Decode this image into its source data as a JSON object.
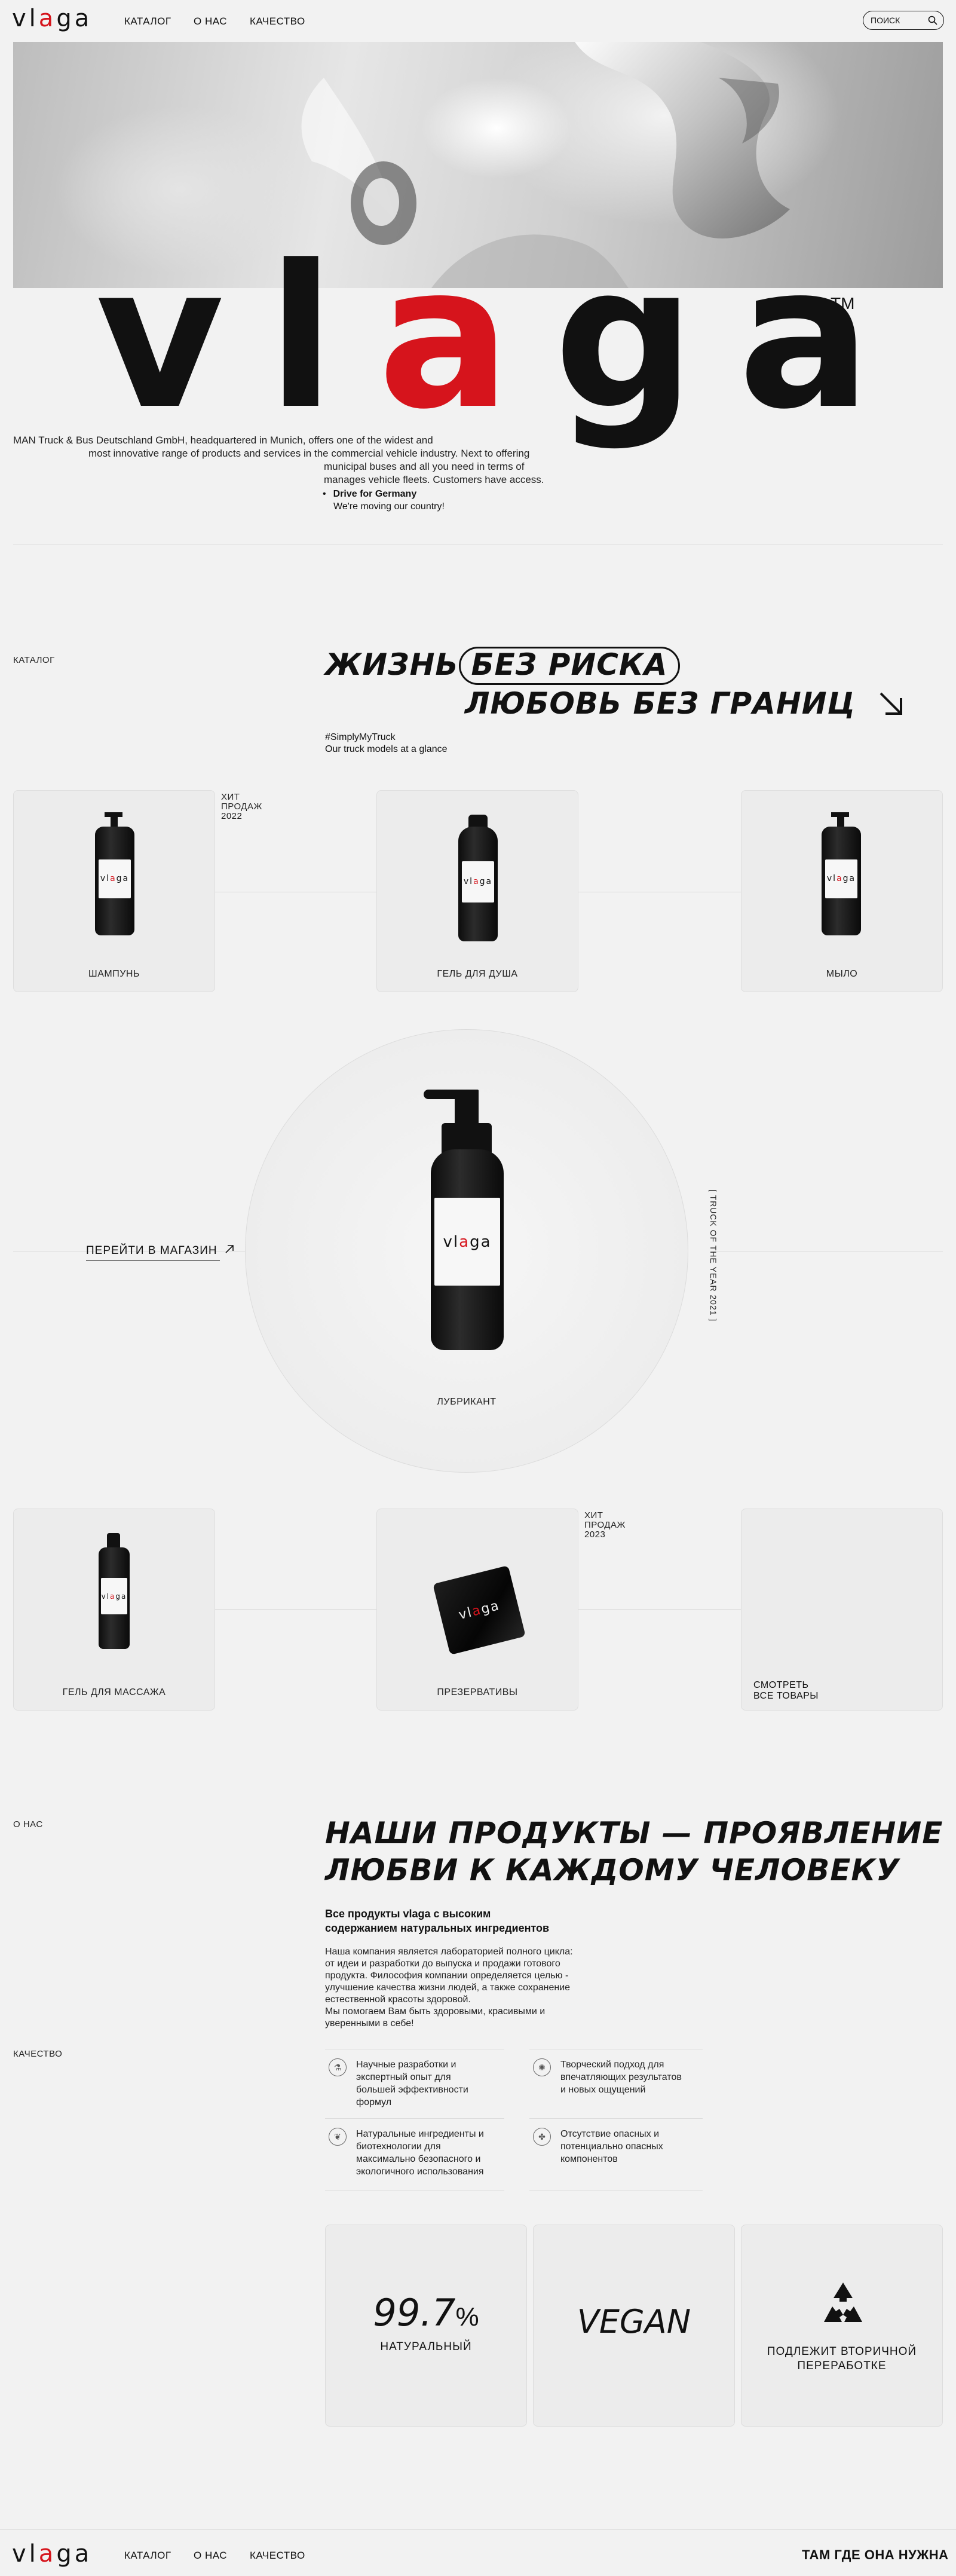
{
  "nav": {
    "logo_parts": [
      "vl",
      "a",
      "ga"
    ],
    "links": [
      "КАТАЛОГ",
      "О НАС",
      "КАЧЕСТВО"
    ],
    "search_label": "ПОИСК"
  },
  "hero": {
    "logo_parts": [
      "vl",
      "a",
      "ga"
    ],
    "trademark": "TM",
    "paragraph_lines": [
      "MAN Truck & Bus Deutschland GmbH, headquartered in Munich, offers one of the widest and",
      "most innovative range of products and services in the commercial vehicle industry. Next to offering",
      "municipal buses and all you need in terms of",
      "manages vehicle fleets. Customers have access."
    ],
    "bullet_title": "Drive for Germany",
    "bullet_text": "We're moving our country!"
  },
  "catalog": {
    "section_label": "КАТАЛОГ",
    "headline_line1_a": "ЖИЗНЬ",
    "headline_line1_pill": "БЕЗ РИСКА",
    "headline_line2": "ЛЮБОВЬ БЕЗ ГРАНИЦ",
    "hashtag": "#SimplyMyTruck",
    "subtitle": "Our truck models at a glance",
    "bestseller_2022": [
      "ХИТ",
      "ПРОДАЖ",
      "2022"
    ],
    "bestseller_2023": [
      "ХИТ",
      "ПРОДАЖ",
      "2023"
    ],
    "products_row1": [
      "ШАМПУНЬ",
      "ГЕЛЬ ДЛЯ ДУША",
      "МЫЛО"
    ],
    "featured_label": "ЛУБРИКАНТ",
    "shop_link": "ПЕРЕЙТИ В МАГАЗИН",
    "award_text": "[ TRUCK OF THE YEAR 2021 ]",
    "products_row2": [
      "ГЕЛЬ ДЛЯ МАССАЖА",
      "ПРЕЗЕРВАТИВЫ"
    ],
    "see_products": [
      "СМОТРЕТЬ",
      "ВСЕ ТОВАРЫ"
    ],
    "bottle_logo": [
      "vl",
      "a",
      "ga"
    ]
  },
  "about": {
    "section_label": "О НАС",
    "quality_label": "КАЧЕСТВО",
    "headline_line1": "НАШИ ПРОДУКТЫ — ПРОЯВЛЕНИЕ",
    "headline_line2": "ЛЮБВИ К КАЖДОМУ ЧЕЛОВЕКУ",
    "subheading_lines": [
      "Все продукты vlaga с высоким",
      "содержанием натуральных ингредиентов"
    ],
    "body_lines": [
      "Наша компания является лабораторией полного цикла:",
      "от идеи и разработки до выпуска и продажи готового",
      "продукта. Философия компании определяется целью -",
      "улучшение качества жизни людей, а также сохранение",
      "естественной красоты здоровой.",
      "Мы помогаем Вам быть здоровыми, красивыми и",
      "уверенными в себе!"
    ],
    "features": [
      {
        "icon": "science-icon",
        "lines": [
          "Научные разработки и",
          "экспертный опыт для",
          "большей эффективности",
          "формул"
        ]
      },
      {
        "icon": "creative-icon",
        "lines": [
          "Творческий подход для",
          "впечатляющих результатов",
          "и новых ощущений"
        ]
      },
      {
        "icon": "natural-icon",
        "lines": [
          "Натуральные ингредиенты и",
          "биотехнологии для",
          "максимально безопасного и",
          "экологичного использования"
        ]
      },
      {
        "icon": "safety-icon",
        "lines": [
          "Отсутствие опасных и",
          "потенциально опасных",
          "компонентов"
        ]
      }
    ],
    "stats": {
      "natural_value": "99.7",
      "natural_unit": "%",
      "natural_label": "НАТУРАЛЬНЫЙ",
      "vegan": "VEGAN",
      "recycle_lines": [
        "ПОДЛЕЖИТ ВТОРИЧНОЙ",
        "ПЕРЕРАБОТКЕ"
      ]
    }
  },
  "footer": {
    "logo_parts": [
      "vl",
      "a",
      "ga"
    ],
    "links": [
      "КАТАЛОГ",
      "О НАС",
      "КАЧЕСТВО"
    ],
    "slogan": "ТАМ ГДЕ ОНА НУЖНА"
  },
  "colors": {
    "accent": "#d6141c",
    "ink": "#111111",
    "background": "#f2f2f2"
  }
}
